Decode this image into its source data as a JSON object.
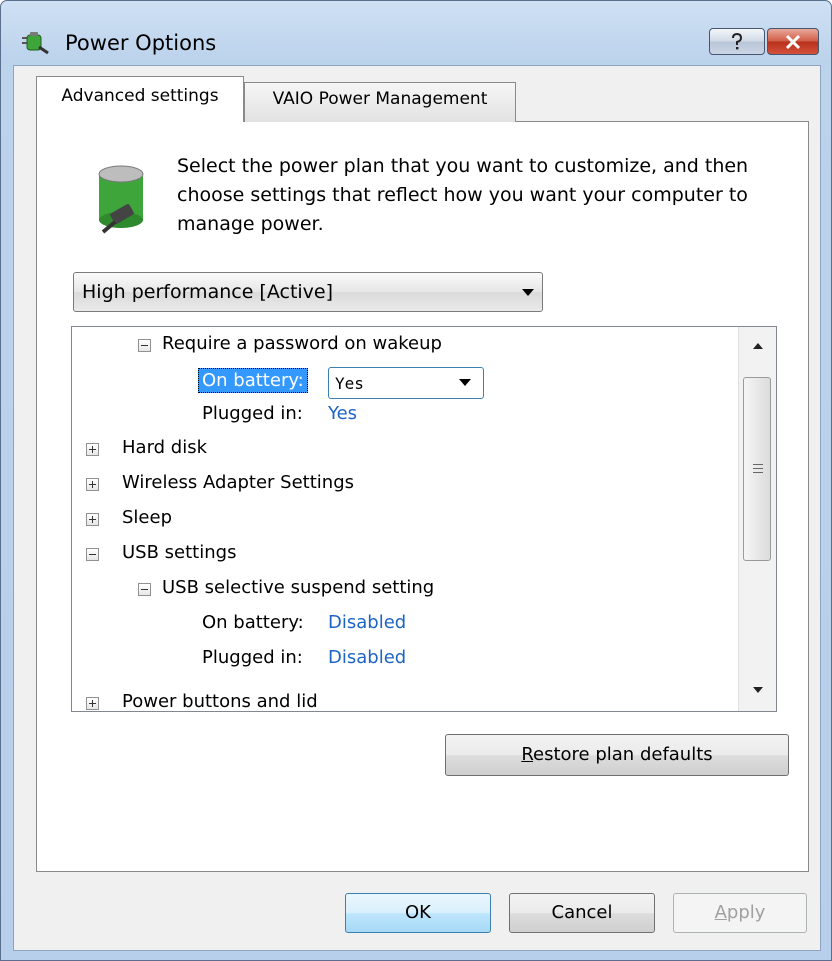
{
  "window": {
    "title": "Power Options"
  },
  "tabs": [
    {
      "label": "Advanced settings",
      "active": true
    },
    {
      "label": "VAIO Power Management",
      "active": false
    }
  ],
  "intro_text": "Select the power plan that you want to customize, and then choose settings that reflect how you want your computer to manage power.",
  "plan_select": {
    "value": "High performance [Active]"
  },
  "tree": {
    "password_wakeup": {
      "label": "Require a password on wakeup",
      "on_battery_label": "On battery:",
      "on_battery_value": "Yes",
      "plugged_in_label": "Plugged in:",
      "plugged_in_value": "Yes"
    },
    "hard_disk": "Hard disk",
    "wireless": "Wireless Adapter Settings",
    "sleep": "Sleep",
    "usb_settings": "USB settings",
    "usb_selective": {
      "label": "USB selective suspend setting",
      "on_battery_label": "On battery:",
      "on_battery_value": "Disabled",
      "plugged_in_label": "Plugged in:",
      "plugged_in_value": "Disabled"
    },
    "power_buttons": "Power buttons and lid"
  },
  "buttons": {
    "restore_prefix": "R",
    "restore_rest": "estore plan defaults",
    "ok": "OK",
    "cancel": "Cancel",
    "apply_prefix": "A",
    "apply_rest": "pply"
  },
  "colors": {
    "value_link": "#1d64c5",
    "selection": "#3399ff"
  }
}
